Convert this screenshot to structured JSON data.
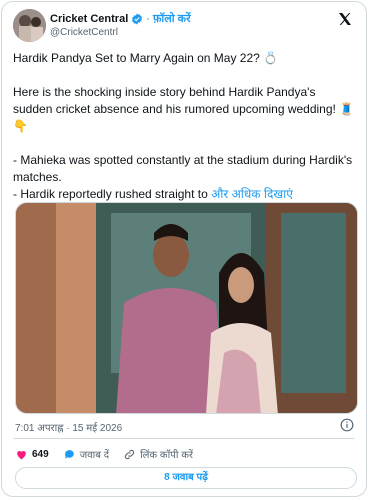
{
  "account": {
    "name": "Cricket Central",
    "follow_label": "फ़ॉलो करें",
    "handle": "@CricketCentrl"
  },
  "tweet": {
    "line1": "Hardik Pandya Set to Marry Again on May 22? 💍",
    "para2": "Here is the shocking inside story behind Hardik Pandya's sudden cricket absence and his rumored upcoming wedding! 🧵👇",
    "bullet1": "- Mahieka was spotted constantly at the stadium during Hardik's matches.",
    "bullet2": "- Hardik reportedly rushed straight to",
    "show_more": "और अधिक दिखाएं",
    "timestamp": "7:01 अपराह्न · 15 मई 2026"
  },
  "actions": {
    "likes": "649",
    "reply_label": "जवाब दें",
    "copy_link_label": "लिंक कॉपी करें"
  },
  "read_replies": "8 जवाब पढ़ें",
  "colors": {
    "accent": "#1d9bf0",
    "like": "#f91880",
    "muted": "#536471",
    "border": "#cfd9de"
  }
}
